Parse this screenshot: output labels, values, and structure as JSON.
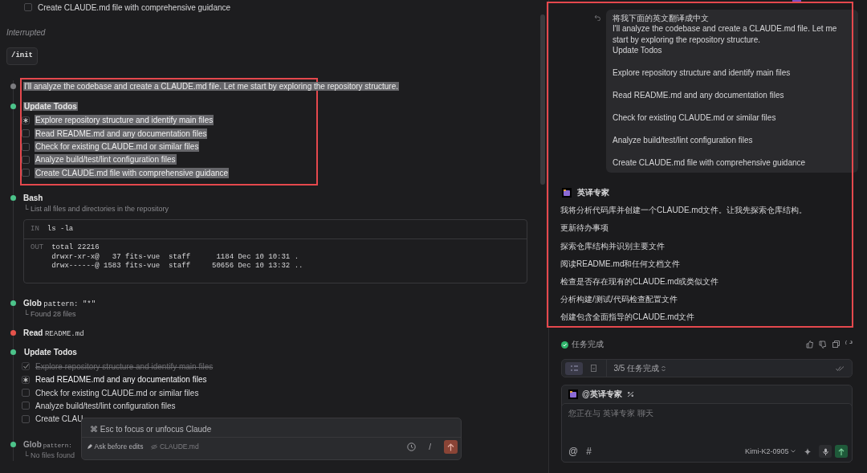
{
  "conversation": {
    "top_todo": {
      "text": "Create CLAUDE.md file with comprehensive guidance",
      "checked": false,
      "active": false
    },
    "interrupted_note": "Interrupted",
    "command": "/init",
    "steps": [
      {
        "kind": "message",
        "color": "#7c7c80",
        "text": "I'll analyze the codebase and create a CLAUDE.md file. Let me start by exploring the repository structure.",
        "text_selected": true,
        "highlighted": true
      },
      {
        "kind": "todos",
        "color": "#4cc38a",
        "title": "Update Todos",
        "text_selected": true,
        "highlighted": true,
        "items": [
          {
            "text": "Explore repository structure and identify main files",
            "checked": false,
            "active": true
          },
          {
            "text": "Read README.md and any documentation files",
            "checked": false,
            "active": false
          },
          {
            "text": "Check for existing CLAUDE.md or similar files",
            "checked": false,
            "active": false
          },
          {
            "text": "Analyze build/test/lint configuration files",
            "checked": false,
            "active": false
          },
          {
            "text": "Create CLAUDE.md file with comprehensive guidance",
            "checked": false,
            "active": false
          }
        ]
      },
      {
        "kind": "tool",
        "color": "#4cc38a",
        "name": "Bash",
        "detail": "└ List all files and directories in the repository",
        "io": {
          "in_label": "IN",
          "input": "ls -la",
          "out_label": "OUT",
          "output": [
            "total 22216",
            "drwxr-xr-x@   37 fits-vue  staff      1184 Dec 10 10:31 .",
            "drwx------@ 1583 fits-vue  staff     50656 Dec 10 13:32 .."
          ]
        }
      },
      {
        "kind": "tool",
        "color": "#4cc38a",
        "name": "Glob",
        "argument": "pattern: \"*\"",
        "detail": "└ Found 28 files"
      },
      {
        "kind": "tool",
        "color": "#e5534b",
        "name": "Read",
        "argument": "README.md"
      },
      {
        "kind": "todos",
        "color": "#4cc38a",
        "title": "Update Todos",
        "items": [
          {
            "text": "Explore repository structure and identify main files",
            "checked": true,
            "active": false
          },
          {
            "text": "Read README.md and any documentation files",
            "checked": false,
            "active": true
          },
          {
            "text": "Check for existing CLAUDE.md or similar files",
            "checked": false,
            "active": false
          },
          {
            "text": "Analyze build/test/lint configuration files",
            "checked": false,
            "active": false
          },
          {
            "text": "Create CLAU",
            "checked": false,
            "active": false
          }
        ]
      },
      {
        "kind": "tool",
        "color": "#4cc38a",
        "name": "Glob",
        "argument": "pattern:",
        "detail": "└ No files found",
        "faded": true
      }
    ]
  },
  "composer": {
    "hint": "⌘ Esc to focus or unfocus Claude",
    "mode": "Ask before edits",
    "context_file": "CLAUDE.md",
    "slash": "/"
  },
  "chat_panel": {
    "highlighted": true,
    "user_message": {
      "lines": [
        "将我下面的英文翻译成中文",
        "I'll analyze the codebase and create a CLAUDE.md file. Let me start by exploring the repository structure.",
        "Update Todos"
      ],
      "todo_lines": [
        "Explore repository structure and identify main files",
        "Read README.md and any documentation files",
        "Check for existing CLAUDE.md or similar files",
        "Analyze build/test/lint configuration files",
        "Create CLAUDE.md file with comprehensive guidance"
      ]
    },
    "assistant": {
      "name": "英译专家",
      "paragraphs": [
        "我将分析代码库并创建一个CLAUDE.md文件。让我先探索仓库结构。",
        "更新待办事项",
        "探索仓库结构并识别主要文件",
        "阅读README.md和任何文档文件",
        "检查是否存在现有的CLAUDE.md或类似文件",
        "分析构建/测试/代码检查配置文件",
        "创建包含全面指导的CLAUDE.md文件"
      ]
    },
    "status": {
      "text": "任务完成",
      "done": true
    },
    "task_bar": {
      "views": [
        {
          "kind": "list",
          "selected": true
        },
        {
          "kind": "doc",
          "selected": false
        }
      ],
      "progress": "3/5 任务完成"
    },
    "composer": {
      "agent": "@英译专家",
      "placeholder": "您正在与 英译专家 聊天",
      "mention": "@",
      "tag": "#",
      "model": "Kimi-K2-0905"
    }
  }
}
